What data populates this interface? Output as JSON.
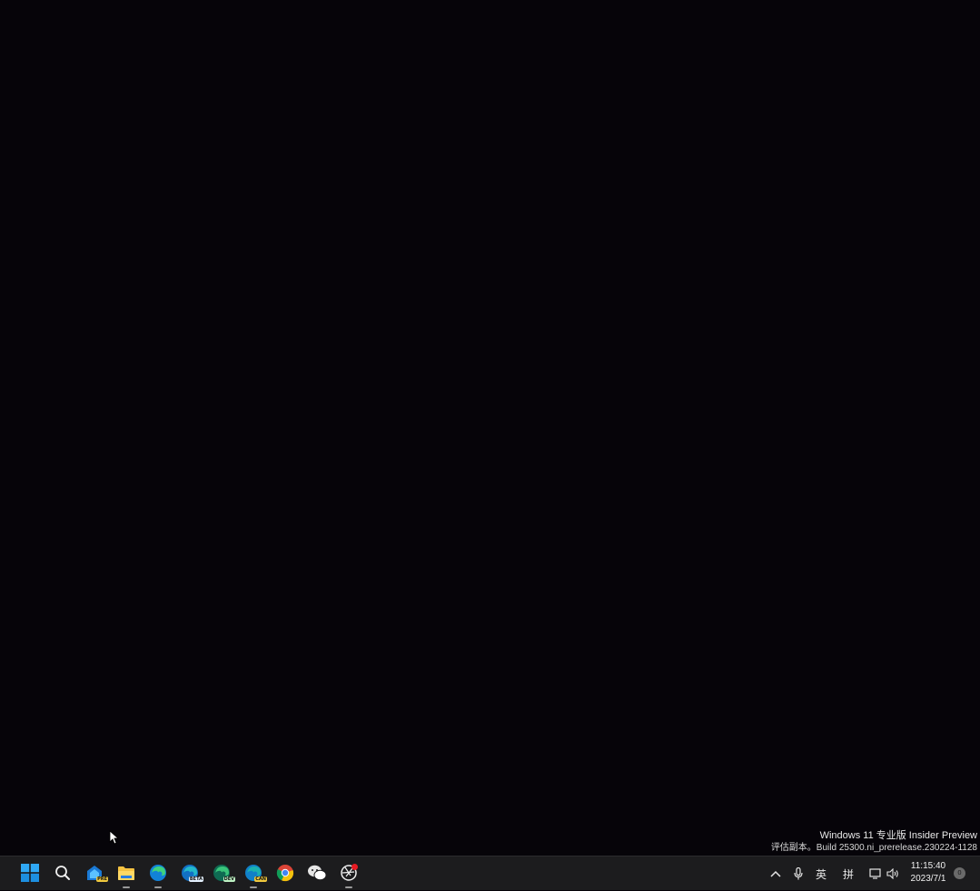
{
  "desktop": {
    "watermark": {
      "line1": "Windows 11 专业版 Insider Preview",
      "line2": "评估副本。Build 25300.ni_prerelease.230224-1128"
    }
  },
  "taskbar": {
    "pinned": [
      {
        "name": "start-button",
        "icon": "windows-logo-icon"
      },
      {
        "name": "search-button",
        "icon": "search-icon"
      },
      {
        "name": "taskbar-app-1",
        "icon": "app-badge-icon",
        "badge": "PRE"
      },
      {
        "name": "taskbar-file-explorer",
        "icon": "folder-icon"
      },
      {
        "name": "taskbar-edge",
        "icon": "edge-icon"
      },
      {
        "name": "taskbar-edge-beta",
        "icon": "edge-icon",
        "badge": "BETA"
      },
      {
        "name": "taskbar-edge-dev",
        "icon": "edge-icon",
        "badge": "DEV"
      },
      {
        "name": "taskbar-edge-canary",
        "icon": "edge-icon",
        "badge": "CAN"
      },
      {
        "name": "taskbar-chrome",
        "icon": "chrome-icon"
      },
      {
        "name": "taskbar-wechat",
        "icon": "wechat-icon"
      },
      {
        "name": "taskbar-app-recorder",
        "icon": "aperture-icon"
      }
    ],
    "tray": {
      "ime_lang": "英",
      "ime_mode": "拼",
      "time": "11:15:40",
      "date": "2023/7/1",
      "notification_count": "0"
    }
  },
  "colors": {
    "desktop_bg": "#060409",
    "taskbar_bg": "#1c1c1e",
    "windows_blue": "#1fa0f0",
    "edge_teal": "#1bb1b0",
    "folder_yellow": "#f6c342"
  }
}
